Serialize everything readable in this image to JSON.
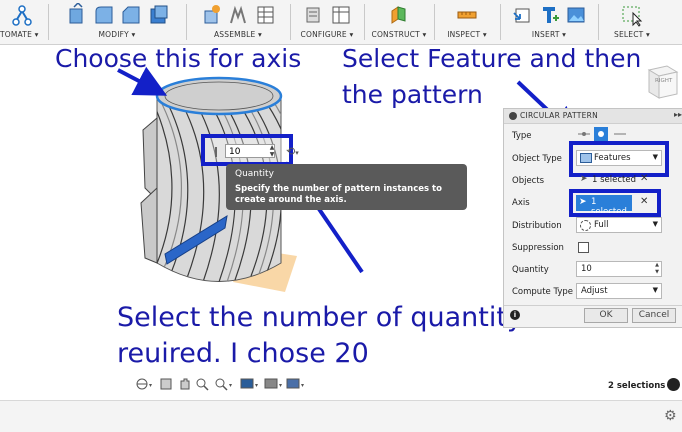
{
  "toolbar": {
    "groups": [
      {
        "label": "TOMATE ▾"
      },
      {
        "label": "MODIFY ▾"
      },
      {
        "label": "ASSEMBLE ▾"
      },
      {
        "label": "CONFIGURE ▾"
      },
      {
        "label": "CONSTRUCT ▾"
      },
      {
        "label": "INSPECT ▾"
      },
      {
        "label": "INSERT ▾"
      },
      {
        "label": "SELECT ▾"
      }
    ]
  },
  "annotations": {
    "axis": "Choose this for axis",
    "feature_line1": "Select Feature and then",
    "feature_line2": "the pattern",
    "quantity_line1": "Select the number of quantity",
    "quantity_line2": "reuired. I chose 20"
  },
  "quantity_inline": {
    "value": "10"
  },
  "tooltip": {
    "title": "Quantity",
    "body": "Specify the number of pattern instances to create around the axis."
  },
  "viewcube": {
    "face": "RIGHT"
  },
  "dialog": {
    "title": "CIRCULAR PATTERN",
    "rows": {
      "type": "Type",
      "object_type": "Object Type",
      "objects": "Objects",
      "axis": "Axis",
      "distribution": "Distribution",
      "suppression": "Suppression",
      "quantity": "Quantity",
      "compute_type": "Compute Type"
    },
    "object_type_value": "Features",
    "objects_value": "1 selected",
    "axis_value": "1 selected",
    "distribution_value": "Full",
    "quantity_value": "10",
    "compute_type_value": "Adjust",
    "ok": "OK",
    "cancel": "Cancel"
  },
  "status": {
    "selections": "2 selections"
  },
  "colors": {
    "annotation": "#1a1aa8",
    "highlight_box": "#1320c8",
    "selected_blue": "#2a7fd9",
    "tooltip_bg": "#5a5a5a"
  }
}
